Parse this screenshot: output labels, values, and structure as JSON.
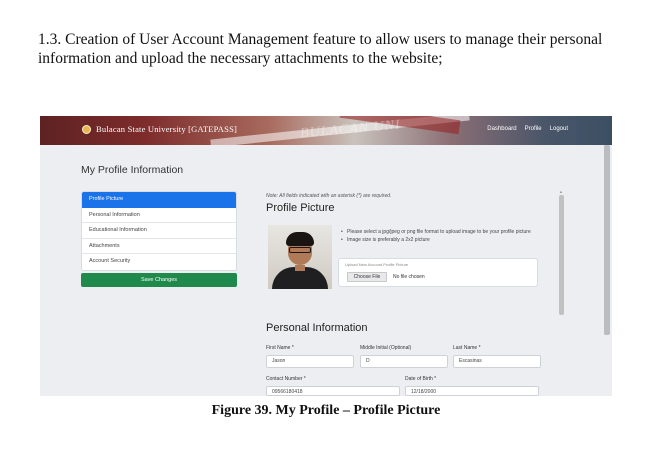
{
  "document": {
    "intro": "1.3. Creation of User Account Management feature to allow users to manage their personal information and upload the necessary attachments to the website;",
    "caption": "Figure 39. My Profile – Profile Picture"
  },
  "header": {
    "brand": "Bulacan State University [GATEPASS]",
    "nav": [
      "Dashboard",
      "Profile",
      "Logout"
    ]
  },
  "page": {
    "title": "My Profile Information"
  },
  "sidebar": {
    "items": [
      {
        "label": "Profile Picture",
        "active": true
      },
      {
        "label": "Personal Information",
        "active": false
      },
      {
        "label": "Educational Information",
        "active": false
      },
      {
        "label": "Attachments",
        "active": false
      },
      {
        "label": "Account Security",
        "active": false
      }
    ],
    "save_label": "Save Changes"
  },
  "profile_picture": {
    "note": "Note: All fields indicated with an asterisk (*) are required.",
    "title": "Profile Picture",
    "bullets": [
      "Please select a jpg/jpeg or png file format to upload image to be your profile picture",
      "Image size is preferably a 2x2 picture"
    ],
    "upload_label": "Upload New Account Profile Picture",
    "choose_label": "Choose File",
    "no_file_label": "No file chosen"
  },
  "personal_info": {
    "title": "Personal Information",
    "first_name_label": "First Name *",
    "first_name": "Jason",
    "middle_initial_label": "Middle Initial (Optional)",
    "middle_initial": "D",
    "last_name_label": "Last Name *",
    "last_name": "Escasinas",
    "contact_label": "Contact Number *",
    "contact": "09566180418",
    "dob_label": "Date of Birth *",
    "dob": "12/18/2000"
  },
  "colors": {
    "active_item": "#1a73e8",
    "save_button": "#1f8a4c",
    "header_maroon": "#7d2b2b"
  }
}
